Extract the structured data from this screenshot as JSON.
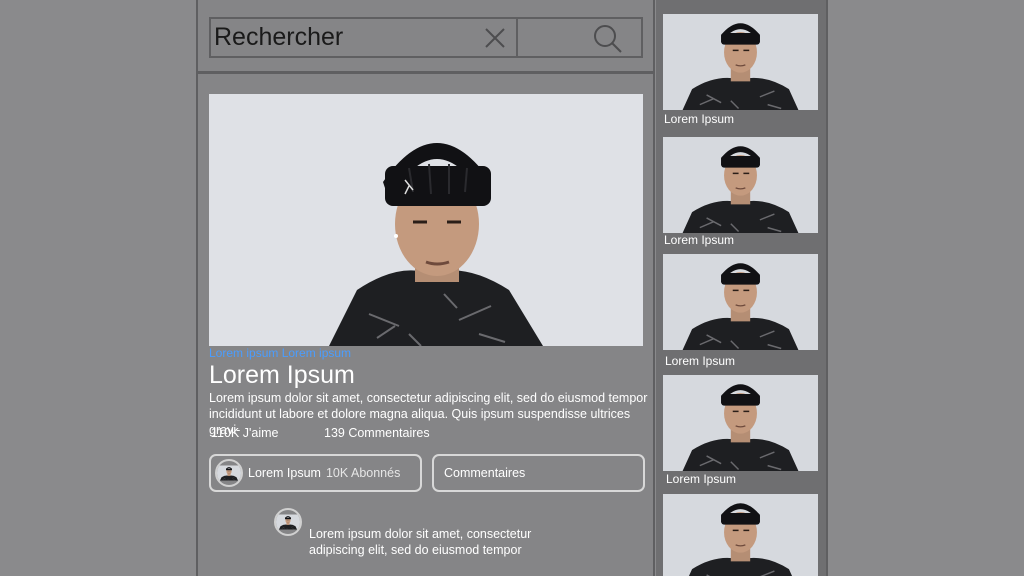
{
  "search": {
    "placeholder": "Rechercher"
  },
  "post": {
    "tags": "Lorem ipsum Lorem ipsum",
    "title": "Lorem Ipsum",
    "description": "Lorem ipsum dolor sit amet, consectetur adipiscing elit, sed do eiusmod tempor incididunt ut labore et dolore magna aliqua. Quis ipsum suspendisse ultrices gravi-",
    "likes": "110K J'aime",
    "comments_count": "139 Commentaires"
  },
  "author": {
    "name": "Lorem Ipsum",
    "subscribers": "10K Abonnés"
  },
  "comments_button": "Commentaires",
  "comment": {
    "text": "Lorem ipsum dolor sit amet, consectetur adipiscing elit, sed do eiusmod tempor"
  },
  "sidebar": {
    "items": [
      {
        "label": "Lorem Ipsum"
      },
      {
        "label": "Lorem Ipsum"
      },
      {
        "label": "Lorem Ipsum"
      },
      {
        "label": "Lorem Ipsum"
      },
      {
        "label": ""
      }
    ]
  },
  "colors": {
    "tag_link": "#4a9dff",
    "background": "#8a8a8c",
    "panel": "#858587"
  }
}
